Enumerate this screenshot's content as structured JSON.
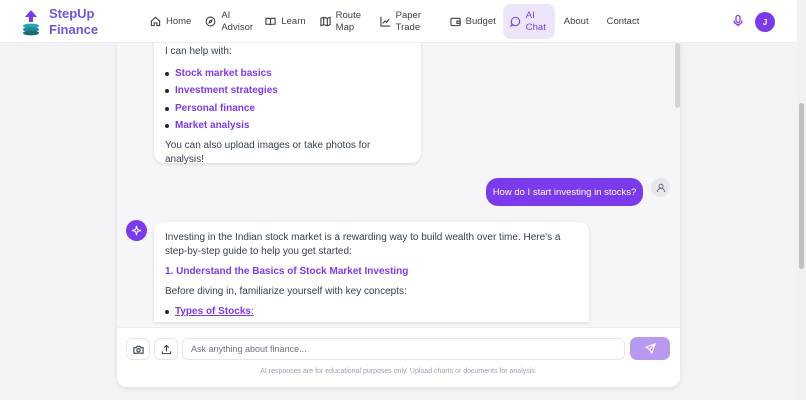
{
  "brand": {
    "line1": "StepUp",
    "line2": "Finance"
  },
  "nav": {
    "items": [
      {
        "label": "Home"
      },
      {
        "label": "AI Advisor"
      },
      {
        "label": "Learn"
      },
      {
        "label": "Route Map"
      },
      {
        "label": "Paper Trade"
      },
      {
        "label": "Budget"
      },
      {
        "label": "AI Chat"
      },
      {
        "label": "About"
      },
      {
        "label": "Contact"
      }
    ],
    "active": "AI Chat"
  },
  "user": {
    "initial": "J"
  },
  "colors": {
    "accent": "#7c3aed",
    "accent_light": "#ede6fb",
    "send_disabled": "#b79af0"
  },
  "chat": {
    "welcome": {
      "intro": "I can help with:",
      "topics": [
        "Stock market basics",
        "Investment strategies",
        "Personal finance",
        "Market analysis"
      ],
      "outro": "You can also upload images or take photos for analysis!"
    },
    "user_message": "How do I start investing in stocks?",
    "reply": {
      "para1": "Investing in the Indian stock market is a rewarding way to build wealth over time. Here's a step-by-step guide to help you get started:",
      "heading1": "1. Understand the Basics of Stock Market Investing",
      "para2": "Before diving in, familiarize yourself with key concepts:",
      "bullet1": "Types of Stocks",
      "bullet1_suffix": ":"
    }
  },
  "composer": {
    "placeholder": "Ask anything about finance...",
    "disclaimer": "AI responses are for educational purposes only. Upload charts or documents for analysis."
  }
}
